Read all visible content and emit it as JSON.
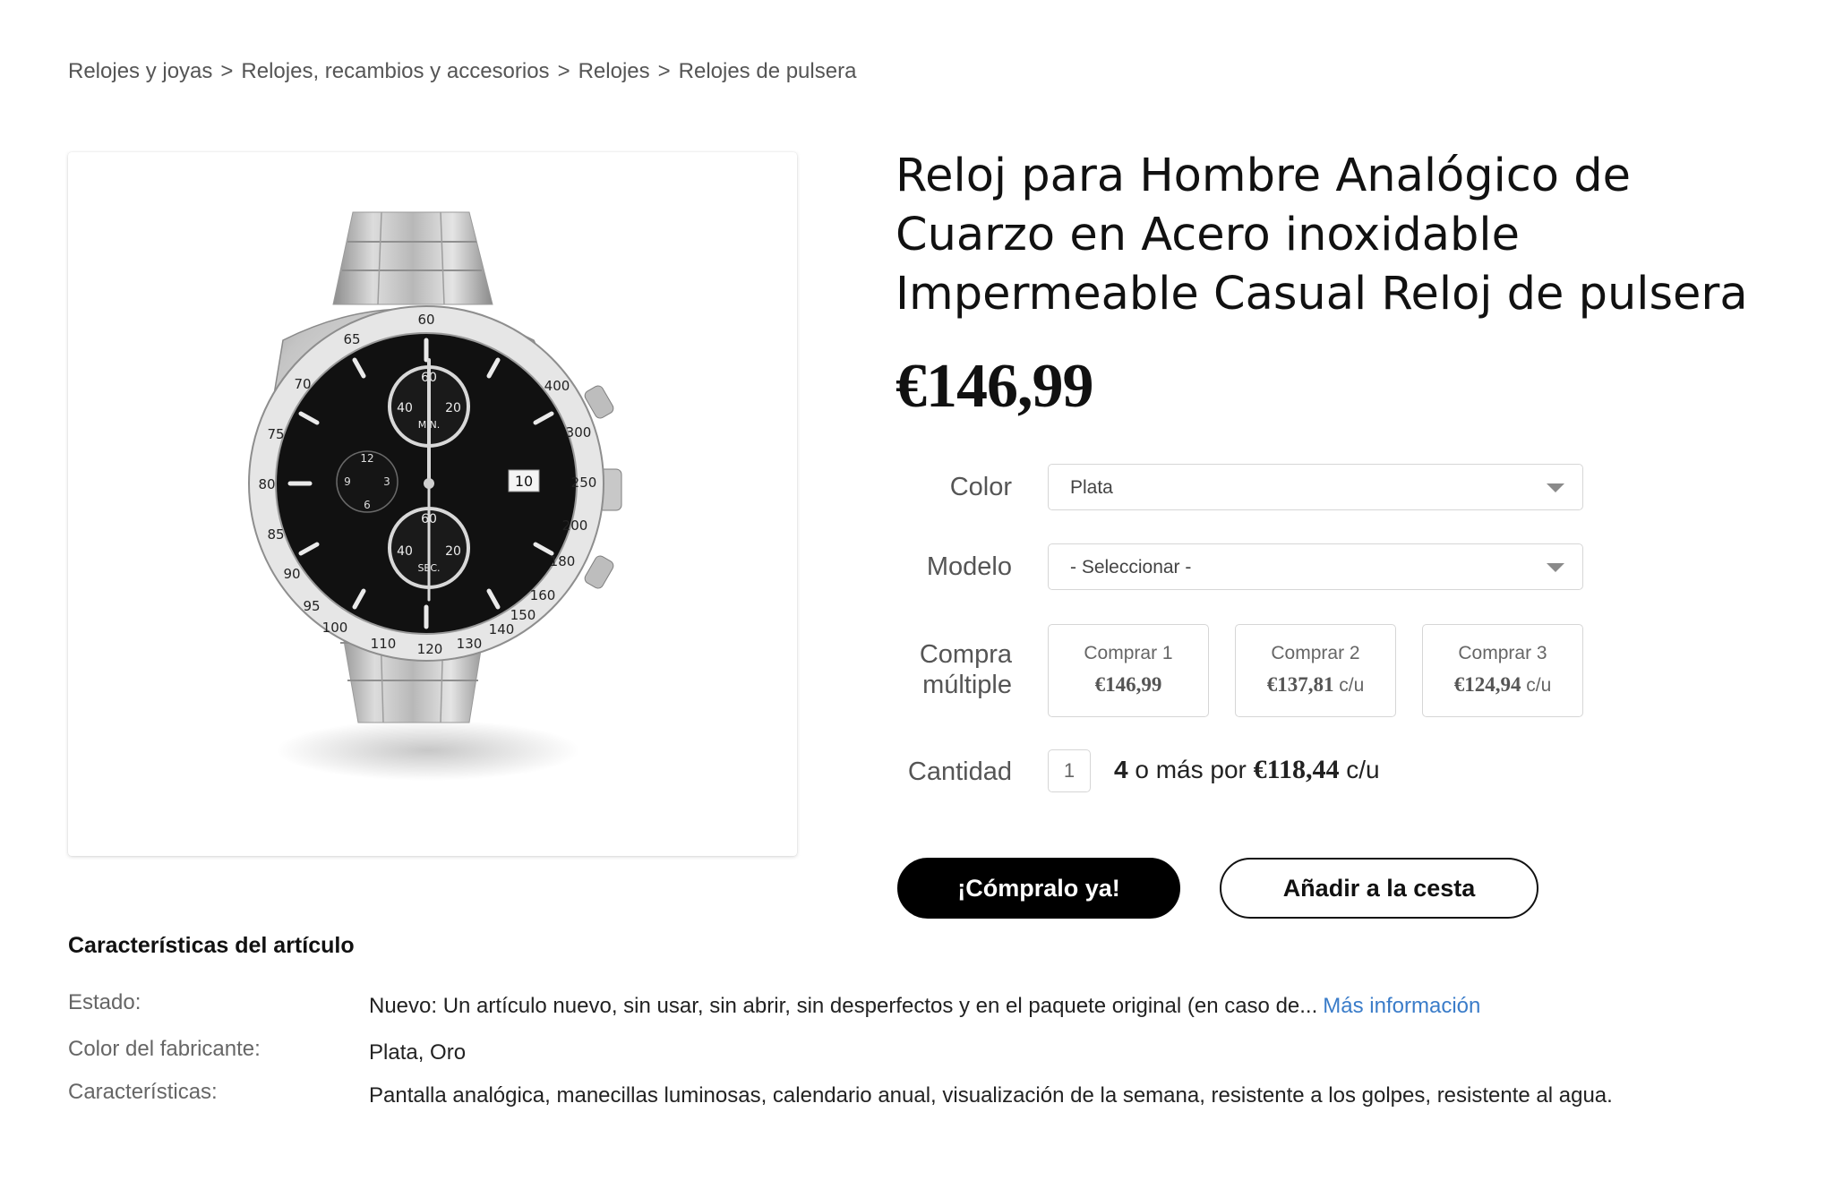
{
  "breadcrumb": {
    "items": [
      "Relojes y joyas",
      "Relojes, recambios y accesorios",
      "Relojes",
      "Relojes de pulsera"
    ],
    "separator": ">"
  },
  "product": {
    "image_alt_icon": "wristwatch-image",
    "title": "Reloj para Hombre Analógico de Cuarzo en Acero inoxidable Impermeable Casual Reloj de pulsera",
    "price": "€146,99"
  },
  "options": {
    "color": {
      "label": "Color",
      "value": "Plata"
    },
    "modelo": {
      "label": "Modelo",
      "value": "- Seleccionar -"
    }
  },
  "multi_buy": {
    "label_line1": "Compra",
    "label_line2": "múltiple",
    "tiers": [
      {
        "label": "Comprar 1",
        "price": "€146,99",
        "unit": ""
      },
      {
        "label": "Comprar 2",
        "price": "€137,81",
        "unit": "c/u"
      },
      {
        "label": "Comprar 3",
        "price": "€124,94",
        "unit": "c/u"
      }
    ]
  },
  "quantity": {
    "label": "Cantidad",
    "value": "1",
    "promo_count": "4",
    "promo_text": "o más por",
    "promo_price": "€118,44",
    "promo_unit": "c/u"
  },
  "actions": {
    "buy_now": "¡Cómpralo ya!",
    "add_to_cart": "Añadir a la cesta"
  },
  "features": {
    "title": "Características del artículo",
    "rows": [
      {
        "label": "Estado:",
        "value": "Nuevo: Un artículo nuevo, sin usar, sin abrir, sin desperfectos y en el paquete original (en caso de...",
        "link": "Más información"
      },
      {
        "label": "Color del fabricante:",
        "value": "Plata, Oro"
      },
      {
        "label": "Características:",
        "value": "Pantalla analógica, manecillas luminosas, calendario anual, visualización de la semana, resistente a los golpes, resistente al agua."
      }
    ]
  },
  "watch_face": {
    "bezel_numbers": [
      "60",
      "65",
      "70",
      "75",
      "80",
      "85",
      "90",
      "95",
      "100",
      "110",
      "120",
      "130",
      "140",
      "150",
      "160",
      "180",
      "200",
      "250",
      "300",
      "400"
    ],
    "subdial_top": [
      "60",
      "40",
      "20",
      "MIN."
    ],
    "subdial_bottom": [
      "60",
      "40",
      "20",
      "SEC."
    ],
    "subdial_left": [
      "12",
      "9",
      "3",
      "6"
    ],
    "date": "10"
  },
  "colors": {
    "text": "#111111",
    "muted": "#555555",
    "border": "#d6d6d6",
    "link": "#3a7cc9",
    "button_primary": "#000000"
  }
}
